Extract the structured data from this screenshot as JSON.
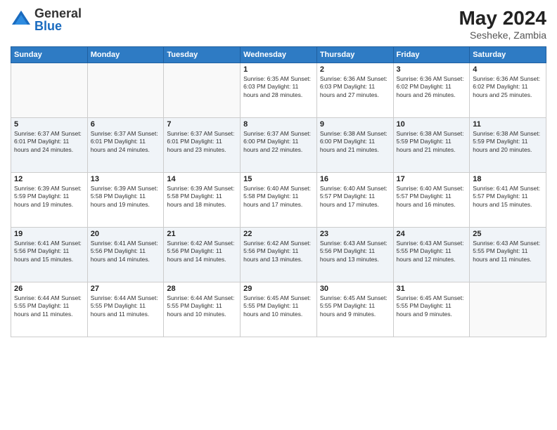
{
  "header": {
    "logo_general": "General",
    "logo_blue": "Blue",
    "month_year": "May 2024",
    "location": "Sesheke, Zambia"
  },
  "days_of_week": [
    "Sunday",
    "Monday",
    "Tuesday",
    "Wednesday",
    "Thursday",
    "Friday",
    "Saturday"
  ],
  "weeks": [
    [
      {
        "day": "",
        "info": "",
        "empty": true
      },
      {
        "day": "",
        "info": "",
        "empty": true
      },
      {
        "day": "",
        "info": "",
        "empty": true
      },
      {
        "day": "1",
        "info": "Sunrise: 6:35 AM\nSunset: 6:03 PM\nDaylight: 11 hours\nand 28 minutes.",
        "empty": false
      },
      {
        "day": "2",
        "info": "Sunrise: 6:36 AM\nSunset: 6:03 PM\nDaylight: 11 hours\nand 27 minutes.",
        "empty": false
      },
      {
        "day": "3",
        "info": "Sunrise: 6:36 AM\nSunset: 6:02 PM\nDaylight: 11 hours\nand 26 minutes.",
        "empty": false
      },
      {
        "day": "4",
        "info": "Sunrise: 6:36 AM\nSunset: 6:02 PM\nDaylight: 11 hours\nand 25 minutes.",
        "empty": false
      }
    ],
    [
      {
        "day": "5",
        "info": "Sunrise: 6:37 AM\nSunset: 6:01 PM\nDaylight: 11 hours\nand 24 minutes.",
        "empty": false
      },
      {
        "day": "6",
        "info": "Sunrise: 6:37 AM\nSunset: 6:01 PM\nDaylight: 11 hours\nand 24 minutes.",
        "empty": false
      },
      {
        "day": "7",
        "info": "Sunrise: 6:37 AM\nSunset: 6:01 PM\nDaylight: 11 hours\nand 23 minutes.",
        "empty": false
      },
      {
        "day": "8",
        "info": "Sunrise: 6:37 AM\nSunset: 6:00 PM\nDaylight: 11 hours\nand 22 minutes.",
        "empty": false
      },
      {
        "day": "9",
        "info": "Sunrise: 6:38 AM\nSunset: 6:00 PM\nDaylight: 11 hours\nand 21 minutes.",
        "empty": false
      },
      {
        "day": "10",
        "info": "Sunrise: 6:38 AM\nSunset: 5:59 PM\nDaylight: 11 hours\nand 21 minutes.",
        "empty": false
      },
      {
        "day": "11",
        "info": "Sunrise: 6:38 AM\nSunset: 5:59 PM\nDaylight: 11 hours\nand 20 minutes.",
        "empty": false
      }
    ],
    [
      {
        "day": "12",
        "info": "Sunrise: 6:39 AM\nSunset: 5:59 PM\nDaylight: 11 hours\nand 19 minutes.",
        "empty": false
      },
      {
        "day": "13",
        "info": "Sunrise: 6:39 AM\nSunset: 5:58 PM\nDaylight: 11 hours\nand 19 minutes.",
        "empty": false
      },
      {
        "day": "14",
        "info": "Sunrise: 6:39 AM\nSunset: 5:58 PM\nDaylight: 11 hours\nand 18 minutes.",
        "empty": false
      },
      {
        "day": "15",
        "info": "Sunrise: 6:40 AM\nSunset: 5:58 PM\nDaylight: 11 hours\nand 17 minutes.",
        "empty": false
      },
      {
        "day": "16",
        "info": "Sunrise: 6:40 AM\nSunset: 5:57 PM\nDaylight: 11 hours\nand 17 minutes.",
        "empty": false
      },
      {
        "day": "17",
        "info": "Sunrise: 6:40 AM\nSunset: 5:57 PM\nDaylight: 11 hours\nand 16 minutes.",
        "empty": false
      },
      {
        "day": "18",
        "info": "Sunrise: 6:41 AM\nSunset: 5:57 PM\nDaylight: 11 hours\nand 15 minutes.",
        "empty": false
      }
    ],
    [
      {
        "day": "19",
        "info": "Sunrise: 6:41 AM\nSunset: 5:56 PM\nDaylight: 11 hours\nand 15 minutes.",
        "empty": false
      },
      {
        "day": "20",
        "info": "Sunrise: 6:41 AM\nSunset: 5:56 PM\nDaylight: 11 hours\nand 14 minutes.",
        "empty": false
      },
      {
        "day": "21",
        "info": "Sunrise: 6:42 AM\nSunset: 5:56 PM\nDaylight: 11 hours\nand 14 minutes.",
        "empty": false
      },
      {
        "day": "22",
        "info": "Sunrise: 6:42 AM\nSunset: 5:56 PM\nDaylight: 11 hours\nand 13 minutes.",
        "empty": false
      },
      {
        "day": "23",
        "info": "Sunrise: 6:43 AM\nSunset: 5:56 PM\nDaylight: 11 hours\nand 13 minutes.",
        "empty": false
      },
      {
        "day": "24",
        "info": "Sunrise: 6:43 AM\nSunset: 5:55 PM\nDaylight: 11 hours\nand 12 minutes.",
        "empty": false
      },
      {
        "day": "25",
        "info": "Sunrise: 6:43 AM\nSunset: 5:55 PM\nDaylight: 11 hours\nand 11 minutes.",
        "empty": false
      }
    ],
    [
      {
        "day": "26",
        "info": "Sunrise: 6:44 AM\nSunset: 5:55 PM\nDaylight: 11 hours\nand 11 minutes.",
        "empty": false
      },
      {
        "day": "27",
        "info": "Sunrise: 6:44 AM\nSunset: 5:55 PM\nDaylight: 11 hours\nand 11 minutes.",
        "empty": false
      },
      {
        "day": "28",
        "info": "Sunrise: 6:44 AM\nSunset: 5:55 PM\nDaylight: 11 hours\nand 10 minutes.",
        "empty": false
      },
      {
        "day": "29",
        "info": "Sunrise: 6:45 AM\nSunset: 5:55 PM\nDaylight: 11 hours\nand 10 minutes.",
        "empty": false
      },
      {
        "day": "30",
        "info": "Sunrise: 6:45 AM\nSunset: 5:55 PM\nDaylight: 11 hours\nand 9 minutes.",
        "empty": false
      },
      {
        "day": "31",
        "info": "Sunrise: 6:45 AM\nSunset: 5:55 PM\nDaylight: 11 hours\nand 9 minutes.",
        "empty": false
      },
      {
        "day": "",
        "info": "",
        "empty": true
      }
    ]
  ]
}
